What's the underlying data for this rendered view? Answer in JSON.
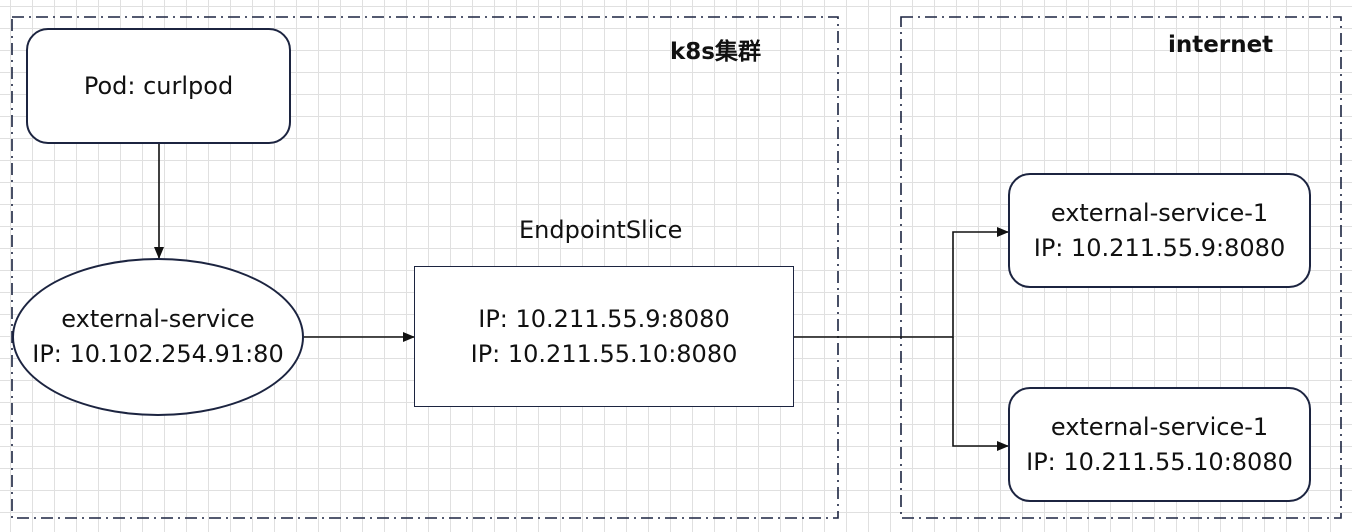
{
  "groups": {
    "cluster": {
      "title": "k8s集群"
    },
    "internet": {
      "title": "internet"
    }
  },
  "pod": {
    "label": "Pod: curlpod"
  },
  "service": {
    "name": "external-service",
    "ip": "IP: 10.102.254.91:80"
  },
  "endpoint_slice": {
    "title": "EndpointSlice",
    "ips": [
      "IP: 10.211.55.9:8080",
      "IP: 10.211.55.10:8080"
    ]
  },
  "externals": [
    {
      "name": "external-service-1",
      "ip": "IP: 10.211.55.9:8080"
    },
    {
      "name": "external-service-1",
      "ip": "IP: 10.211.55.10:8080"
    }
  ],
  "colors": {
    "stroke": "#1c2440",
    "grid": "#e0e0e0",
    "background": "#ffffff"
  }
}
